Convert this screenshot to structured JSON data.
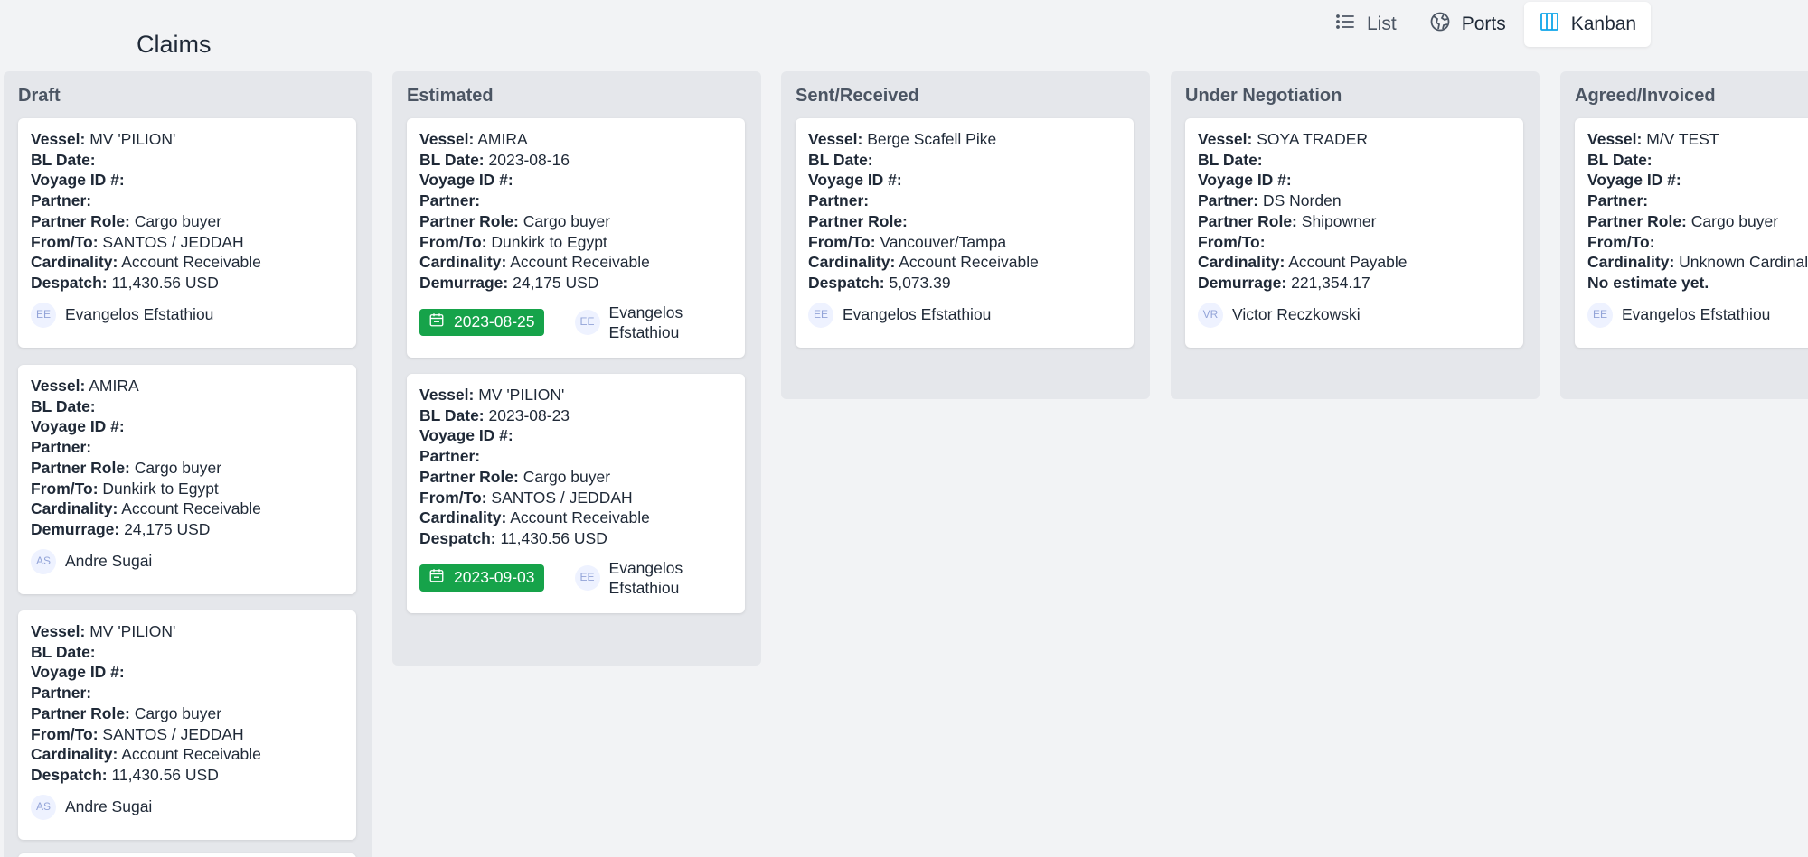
{
  "page": {
    "title": "Claims"
  },
  "views": [
    {
      "label": "List",
      "icon": "list-icon",
      "active": false
    },
    {
      "label": "Ports",
      "icon": "globe-icon",
      "active": false
    },
    {
      "label": "Kanban",
      "icon": "kanban-icon",
      "active": true
    }
  ],
  "columns": [
    {
      "title": "Draft",
      "cards": [
        {
          "fields": [
            [
              "Vessel:",
              "MV 'PILION'"
            ],
            [
              "BL Date:",
              ""
            ],
            [
              "Voyage ID #:",
              ""
            ],
            [
              "Partner:",
              ""
            ],
            [
              "Partner Role:",
              "Cargo buyer"
            ],
            [
              "From/To:",
              "SANTOS / JEDDAH"
            ],
            [
              "Cardinality:",
              "Account Receivable"
            ],
            [
              "Despatch:",
              "11,430.56 USD"
            ]
          ],
          "initials": "EE",
          "assignee": "Evangelos Efstathiou"
        },
        {
          "fields": [
            [
              "Vessel:",
              "AMIRA"
            ],
            [
              "BL Date:",
              ""
            ],
            [
              "Voyage ID #:",
              ""
            ],
            [
              "Partner:",
              ""
            ],
            [
              "Partner Role:",
              "Cargo buyer"
            ],
            [
              "From/To:",
              "Dunkirk to Egypt"
            ],
            [
              "Cardinality:",
              "Account Receivable"
            ],
            [
              "Demurrage:",
              "24,175 USD"
            ]
          ],
          "initials": "AS",
          "assignee": "Andre Sugai"
        },
        {
          "fields": [
            [
              "Vessel:",
              "MV 'PILION'"
            ],
            [
              "BL Date:",
              ""
            ],
            [
              "Voyage ID #:",
              ""
            ],
            [
              "Partner:",
              ""
            ],
            [
              "Partner Role:",
              "Cargo buyer"
            ],
            [
              "From/To:",
              "SANTOS / JEDDAH"
            ],
            [
              "Cardinality:",
              "Account Receivable"
            ],
            [
              "Despatch:",
              "11,430.56 USD"
            ]
          ],
          "initials": "AS",
          "assignee": "Andre Sugai"
        }
      ]
    },
    {
      "title": "Estimated",
      "cards": [
        {
          "fields": [
            [
              "Vessel:",
              "AMIRA"
            ],
            [
              "BL Date:",
              "2023-08-16"
            ],
            [
              "Voyage ID #:",
              ""
            ],
            [
              "Partner:",
              ""
            ],
            [
              "Partner Role:",
              "Cargo buyer"
            ],
            [
              "From/To:",
              "Dunkirk to Egypt"
            ],
            [
              "Cardinality:",
              "Account Receivable"
            ],
            [
              "Demurrage:",
              "24,175 USD"
            ]
          ],
          "date": "2023-08-25",
          "initials": "EE",
          "assignee": "Evangelos Efstathiou"
        },
        {
          "fields": [
            [
              "Vessel:",
              "MV 'PILION'"
            ],
            [
              "BL Date:",
              "2023-08-23"
            ],
            [
              "Voyage ID #:",
              ""
            ],
            [
              "Partner:",
              ""
            ],
            [
              "Partner Role:",
              "Cargo buyer"
            ],
            [
              "From/To:",
              "SANTOS / JEDDAH"
            ],
            [
              "Cardinality:",
              "Account Receivable"
            ],
            [
              "Despatch:",
              "11,430.56 USD"
            ]
          ],
          "date": "2023-09-03",
          "initials": "EE",
          "assignee": "Evangelos Efstathiou"
        }
      ]
    },
    {
      "title": "Sent/Received",
      "cards": [
        {
          "fields": [
            [
              "Vessel:",
              "Berge Scafell Pike"
            ],
            [
              "BL Date:",
              ""
            ],
            [
              "Voyage ID #:",
              ""
            ],
            [
              "Partner:",
              ""
            ],
            [
              "Partner Role:",
              ""
            ],
            [
              "From/To:",
              "Vancouver/Tampa"
            ],
            [
              "Cardinality:",
              "Account Receivable"
            ],
            [
              "Despatch:",
              "5,073.39"
            ]
          ],
          "initials": "EE",
          "assignee": "Evangelos Efstathiou"
        }
      ]
    },
    {
      "title": "Under Negotiation",
      "cards": [
        {
          "fields": [
            [
              "Vessel:",
              "SOYA TRADER"
            ],
            [
              "BL Date:",
              ""
            ],
            [
              "Voyage ID #:",
              ""
            ],
            [
              "Partner:",
              "DS Norden"
            ],
            [
              "Partner Role:",
              "Shipowner"
            ],
            [
              "From/To:",
              ""
            ],
            [
              "Cardinality:",
              "Account Payable"
            ],
            [
              "Demurrage:",
              "221,354.17"
            ]
          ],
          "initials": "VR",
          "assignee": "Victor Reczkowski"
        }
      ]
    },
    {
      "title": "Agreed/Invoiced",
      "cards": [
        {
          "fields": [
            [
              "Vessel:",
              "M/V TEST"
            ],
            [
              "BL Date:",
              ""
            ],
            [
              "Voyage ID #:",
              ""
            ],
            [
              "Partner:",
              ""
            ],
            [
              "Partner Role:",
              "Cargo buyer"
            ],
            [
              "From/To:",
              ""
            ],
            [
              "Cardinality:",
              "Unknown Cardinality"
            ],
            [
              "No estimate yet.",
              ""
            ]
          ],
          "initials": "EE",
          "assignee": "Evangelos Efstathiou"
        }
      ]
    }
  ]
}
